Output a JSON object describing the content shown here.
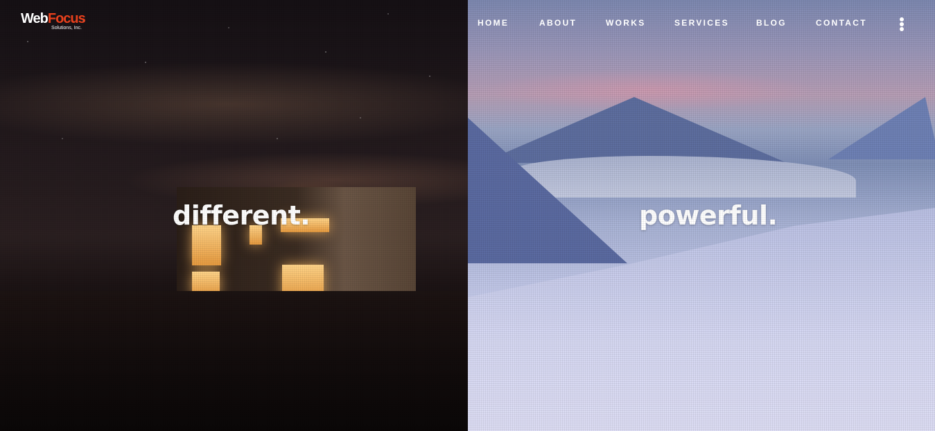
{
  "brand": {
    "logo_main_web": "Web",
    "logo_main_focus": "Focus",
    "logo_sub": "Solutions, Inc.",
    "colors": {
      "web": "#ffffff",
      "focus": "#e8401c"
    }
  },
  "nav": {
    "items": [
      {
        "label": "HOME"
      },
      {
        "label": "ABOUT"
      },
      {
        "label": "WORKS"
      },
      {
        "label": "SERVICES"
      },
      {
        "label": "BLOG"
      },
      {
        "label": "CONTACT"
      }
    ],
    "menu_icon": "more-vertical-icon"
  },
  "hero": {
    "left_headline": "different.",
    "right_headline": "powerful.",
    "left_scene": "night-cabin-photo",
    "right_scene": "snowy-fjord-photo"
  }
}
